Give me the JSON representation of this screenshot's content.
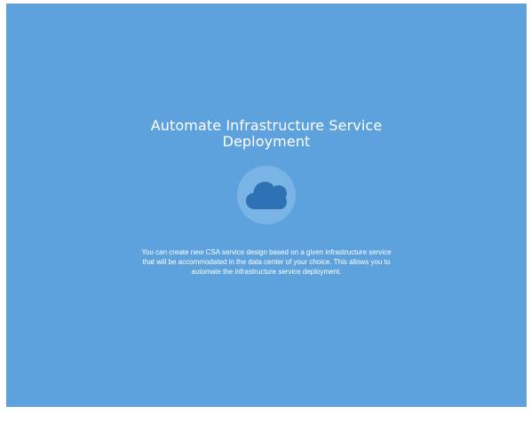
{
  "card": {
    "title_line1": "Automate Infrastructure Service",
    "title_line2": "Deployment",
    "icon": "cloud-icon",
    "description_line1": "You can create new CSA service design based on a given infrastructure service",
    "description_line2": "that will be accommodated in the data center of your choice. This allows you to",
    "description_line3": "automate the infrastructure service deployment."
  },
  "colors": {
    "panel_background": "#5ea2dd",
    "icon_circle": "#7ab4e6",
    "cloud": "#2e71b4",
    "text": "#ffffff"
  }
}
